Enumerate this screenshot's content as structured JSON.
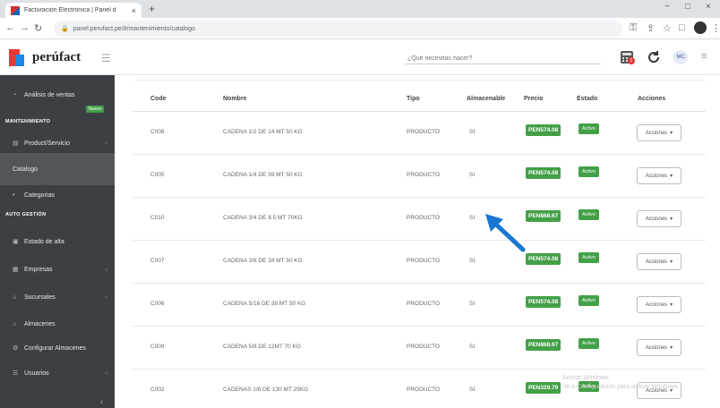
{
  "browser": {
    "tab_title": "Facturación Electrónica | Panel d",
    "tab_close": "×",
    "new_tab": "+",
    "url": "panel.perufact.pe/#/mantenimiento/catalogo",
    "win_min": "−",
    "win_max": "□",
    "win_close": "×"
  },
  "header": {
    "logo_text": "perúfact",
    "search_placeholder": "¿Qué necesitas hacer?",
    "notif_count": "1",
    "avatar_initials": "MC"
  },
  "sidebar": {
    "items": [
      {
        "label": "Análisis de ventas",
        "badge": "Nuevo"
      },
      {
        "label": "MANTENIMIENTO"
      },
      {
        "label": "Product/Servicio"
      },
      {
        "label": "Catalogo"
      },
      {
        "label": "Categorias"
      },
      {
        "label": "AUTO GESTIÓN"
      },
      {
        "label": "Estado de alta"
      },
      {
        "label": "Empresas"
      },
      {
        "label": "Sucursales"
      },
      {
        "label": "Almacenes"
      },
      {
        "label": "Configurar Almacenes"
      },
      {
        "label": "Usuarios"
      }
    ],
    "collapse_label": "‹"
  },
  "table": {
    "columns": [
      "Code",
      "Nombre",
      "Tipo",
      "Almacenable",
      "Precio",
      "Estado",
      "Acciones"
    ],
    "rows": [
      {
        "code": "C008",
        "nombre": "CADENA 1/2 DE 14 MT 50 KG",
        "tipo": "PRODUCTO",
        "almacenable": "SI",
        "precio": "PEN574.08",
        "estado": "Activo",
        "acciones": "Acciones"
      },
      {
        "code": "C005",
        "nombre": "CADENA 1/4 DE 59 MT 50 KG",
        "tipo": "PRODUCTO",
        "almacenable": "SI",
        "precio": "PEN574.08",
        "estado": "Activo",
        "acciones": "Acciones"
      },
      {
        "code": "C010",
        "nombre": "CADENA 3/4 DE 8.5 MT 70KG",
        "tipo": "PRODUCTO",
        "almacenable": "SI",
        "precio": "PEN868.67",
        "estado": "Activo",
        "acciones": "Acciones"
      },
      {
        "code": "C007",
        "nombre": "CADENA 3/8 DE 34 MT 50 KG",
        "tipo": "PRODUCTO",
        "almacenable": "SI",
        "precio": "PEN574.08",
        "estado": "Activo",
        "acciones": "Acciones"
      },
      {
        "code": "C006",
        "nombre": "CADENA 5/16 DE 38 MT 50 KG",
        "tipo": "PRODUCTO",
        "almacenable": "SI",
        "precio": "PEN574.08",
        "estado": "Activo",
        "acciones": "Acciones"
      },
      {
        "code": "C009",
        "nombre": "CADENA 5/8 DE 12MT 70 KG",
        "tipo": "PRODUCTO",
        "almacenable": "SI",
        "precio": "PEN868.67",
        "estado": "Activo",
        "acciones": "Acciones"
      },
      {
        "code": "C002",
        "nombre": "CADENAS 1/8 DE 130 MT 25KG",
        "tipo": "PRODUCTO",
        "almacenable": "SI",
        "precio": "PEN329.79",
        "estado": "Activo",
        "acciones": "Acciones"
      }
    ]
  },
  "watermark": {
    "line1": "Activar Windows",
    "line2": "Ve a Configuración para activar Windows."
  },
  "colors": {
    "sidebar_bg": "#3c4045",
    "badge_green": "#43a047",
    "arrow_blue": "#1976d2"
  },
  "icons": {
    "browser": [
      "back-icon",
      "forward-icon",
      "reload-icon",
      "lock-icon",
      "star-icon",
      "extension-icon"
    ],
    "header": [
      "hamburger-icon",
      "calculator-icon",
      "refresh-icon",
      "menu-icon"
    ],
    "annotation": "arrow-pointer-icon"
  }
}
